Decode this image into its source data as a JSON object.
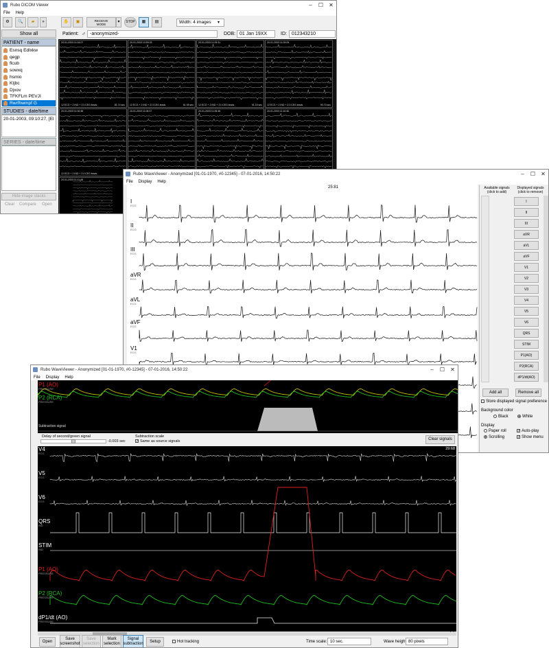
{
  "dicom": {
    "title": "Rubo DICOM Viewer",
    "menu": [
      "File",
      "Help"
    ],
    "toolbar": {
      "receive_mode": "RECEIVE\nMODE",
      "stop": "STOP",
      "width_select": "Width: 4 images"
    },
    "show_all": "Show all",
    "patient_header": "PATIENT - name",
    "patients": [
      "Esnsq Edlxkw",
      "qegp",
      "flcub",
      "sowxq",
      "hsmio",
      "Ktjbc",
      "Djxov",
      "TFKFLm PEVJI",
      "Rwrfhwmpf G"
    ],
    "studies_header": "STUDIES - date/time",
    "study_item": "20-01-2003, 09:10:27, [El",
    "series_header": "SERIES - date/time",
    "hide_stacks": "Hide image stacks",
    "bottom_buttons": [
      "Clear",
      "Compare",
      "Open"
    ],
    "patient_label": "Patient:",
    "patient_name": "-anonymized-",
    "dob_label": "DOB:",
    "dob": "01 Jan 19XX",
    "id_label": "ID:",
    "id": "012343210",
    "thumbs_row1": [
      {
        "time": "20-01-2003 11:04:07",
        "foot": "12 ECG + 2 IND + 21 ICEG leads",
        "side": "81.74 sec"
      },
      {
        "time": "20-01-2003 10:59:33",
        "foot": "12 ECG + 2 IND + 21 ICEG leads",
        "side": "61.95 sec"
      },
      {
        "time": "20-01-2003 11:09:31",
        "foot": "12 ECG + 2 IND + 21 ICEG leads",
        "side": "91.15 sec"
      },
      {
        "time": "20-01-2003 11:09:09",
        "foot": "12 ECG + 2 IND + 21 ICEG leads",
        "side": "90.73 sec"
      }
    ],
    "thumbs_row2": [
      {
        "time": "20-01-2003 11:00:48",
        "foot": "12 ECG + 2 IND + 21 ICEG leads",
        "side": ""
      },
      {
        "time": "20-01-2003 11:06:07",
        "foot": "12 ECG + 2 IND + 21 ICEG leads",
        "side": ""
      },
      {
        "time": "20-01-2003 11:06:46",
        "foot": "12 ECG + 2 IND + 21 ICEG leads",
        "side": ""
      },
      {
        "time": "20-01-2003 11:10:40",
        "foot": "12 ECG + 2 IND + 21 ICEG leads",
        "side": ""
      }
    ],
    "thumb_row3_time": "20-01-2003 11:11:48"
  },
  "wave1": {
    "title": "Rubo WaveViewer  -  Anonymized [01-01-1970, #0-12345]  -  07-01-2016, 14:50:22",
    "menu": [
      "File",
      "Display",
      "Help"
    ],
    "time_readout": "25:81",
    "leads": [
      {
        "name": "I",
        "sub": "ECG"
      },
      {
        "name": "II",
        "sub": "ECG"
      },
      {
        "name": "III",
        "sub": "ECG"
      },
      {
        "name": "aVR",
        "sub": "ECG"
      },
      {
        "name": "aVL",
        "sub": "ECG"
      },
      {
        "name": "aVF",
        "sub": "ECG"
      },
      {
        "name": "V1",
        "sub": "ECG"
      }
    ],
    "available_header": "Available signals\n(click to add)",
    "displayed_header": "Displayed signals\n(click to remove)",
    "displayed_signals": [
      "I",
      "II",
      "III",
      "aVR",
      "aVL",
      "aVF",
      "V1",
      "V2",
      "V3",
      "V4",
      "V5",
      "V6",
      "QRS",
      "STIM",
      "P1(AO)",
      "P2(RCA)",
      "dP1/dt(AO)"
    ],
    "add_all": "Add all",
    "remove_all": "Remove all",
    "store_pref": "Store displayed signal preference",
    "bg_color_label": "Background color",
    "bg_black": "Black",
    "bg_white": "White",
    "display_label": "Display",
    "paper_roll": "Paper roll",
    "scrolling": "Scrolling",
    "auto_play": "Auto-play",
    "show_menu": "Show menu"
  },
  "wave2": {
    "title": "Rubo WaveViewer  -  Anonymized [01-01-1970, #0-12345]  -  07-01-2016, 14:50:22",
    "menu": [
      "File",
      "Display",
      "Help"
    ],
    "top_signals": [
      {
        "name": "P1  (AO)",
        "sub": "PRESSURE",
        "color": "#e02020"
      },
      {
        "name": "P2  (RCA)",
        "sub": "PRESSURE",
        "color": "#20c020"
      }
    ],
    "subtraction_label": "Subtraction signal",
    "delay_label": "Delay of second/green signal",
    "delay_value": "-0.003 sec",
    "scale_label": "Subtraction scale",
    "same_scale": "Same as source signals",
    "clear_signals": "Clear signals",
    "time_readout": "29:68",
    "signals": [
      {
        "name": "V4",
        "sub": "ECG",
        "color": "#ffffff"
      },
      {
        "name": "V5",
        "sub": "ECG",
        "color": "#ffffff"
      },
      {
        "name": "V6",
        "sub": "ECG",
        "color": "#ffffff"
      },
      {
        "name": "QRS",
        "sub": "IND",
        "color": "#ffffff"
      },
      {
        "name": "STIM",
        "sub": "IND",
        "color": "#ffffff"
      },
      {
        "name": "P1  (AO)",
        "sub": "PRESSURE",
        "color": "#e02020"
      },
      {
        "name": "P2  (RCA)",
        "sub": "PRESSURE",
        "color": "#20c020"
      },
      {
        "name": "dP1/dt  (AO)",
        "sub": "PRESSURE",
        "color": "#ffffff"
      }
    ],
    "buttons": [
      "Open",
      "Save\nscreenshot",
      "Save\nselection",
      "Mark\nselection",
      "Signal\nsubtraction",
      "Setup"
    ],
    "hot_tracking": "Hot tracking",
    "time_scale_label": "Time scale:",
    "time_scale": "10 sec.",
    "wave_height_label": "Wave height:",
    "wave_height": "80 pixels"
  }
}
